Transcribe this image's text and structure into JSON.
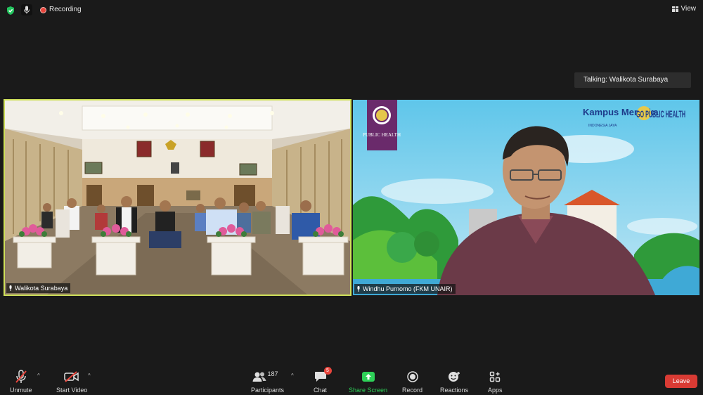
{
  "top_bar": {
    "recording_label": "Recording",
    "view_label": "View"
  },
  "talking_indicator": "Talking: Walikota Surabaya",
  "video_tiles": [
    {
      "participant_name": "Walikota Surabaya",
      "active_speaker": true
    },
    {
      "participant_name": "Windhu Purnomo (FKM UNAIR)",
      "background_texts": {
        "public_health_logo": "PUBLIC HEALTH",
        "kampus_merdeka": "Kampus Merdeka",
        "kampus_merdeka_sub": "INDONESIA JAYA",
        "go_public_health": "GO PUBLIC HEALTH"
      }
    }
  ],
  "toolbar": {
    "unmute_label": "Unmute",
    "start_video_label": "Start Video",
    "participants_label": "Participants",
    "participants_count": "187",
    "chat_label": "Chat",
    "chat_badge": "5",
    "share_screen_label": "Share Screen",
    "record_label": "Record",
    "reactions_label": "Reactions",
    "apps_label": "Apps",
    "leave_label": "Leave"
  },
  "colors": {
    "background": "#1a1a1a",
    "active_speaker_border": "#cfe05a",
    "share_screen_green": "#2ed158",
    "leave_red": "#d93b34",
    "muted_red": "#e8453c"
  }
}
